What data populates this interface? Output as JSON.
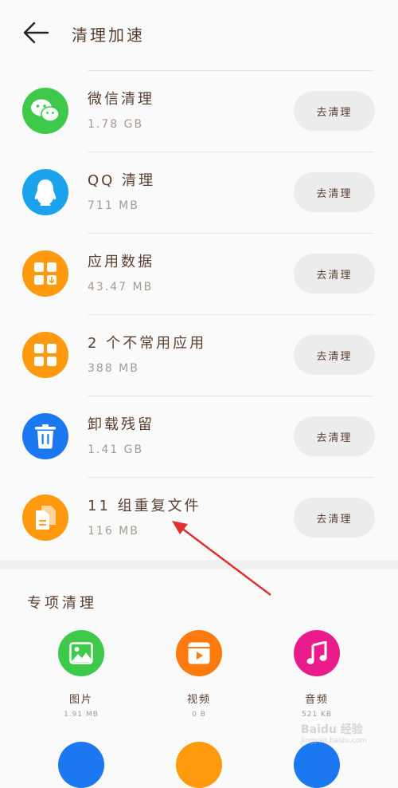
{
  "header": {
    "title": "清理加速"
  },
  "rows": [
    {
      "name": "微信清理",
      "size": "1.78 GB",
      "button": "去清理",
      "color": "#3fc94a",
      "icon": "wechat-icon"
    },
    {
      "name": "QQ 清理",
      "size": "711 MB",
      "button": "去清理",
      "color": "#1aa3ec",
      "icon": "qq-penguin-icon"
    },
    {
      "name": "应用数据",
      "size": "43.47 MB",
      "button": "去清理",
      "color": "#ff9a0e",
      "icon": "app-data-icon"
    },
    {
      "name": "2 个不常用应用",
      "size": "388 MB",
      "button": "去清理",
      "color": "#ff9a0e",
      "icon": "apps-grid-icon"
    },
    {
      "name": "卸载残留",
      "size": "1.41 GB",
      "button": "去清理",
      "color": "#1c78f0",
      "icon": "trash-icon"
    },
    {
      "name": "11 组重复文件",
      "size": "116 MB",
      "button": "去清理",
      "color": "#ff9a0e",
      "icon": "duplicate-file-icon"
    }
  ],
  "special": {
    "title": "专项清理",
    "items": [
      {
        "label": "图片",
        "size": "1.91 MB",
        "color": "#3fc94a",
        "icon": "image-icon"
      },
      {
        "label": "视频",
        "size": "0 B",
        "color": "#ff7a0e",
        "icon": "video-icon"
      },
      {
        "label": "音频",
        "size": "521 KB",
        "color": "#ea1c8c",
        "icon": "music-note-icon"
      }
    ],
    "peek_colors": [
      "#1c78f0",
      "#ff9a0e",
      "#1c78f0"
    ]
  },
  "watermark": {
    "line1": "Baidu 经验",
    "line2": "jingyan.baidu.com"
  }
}
